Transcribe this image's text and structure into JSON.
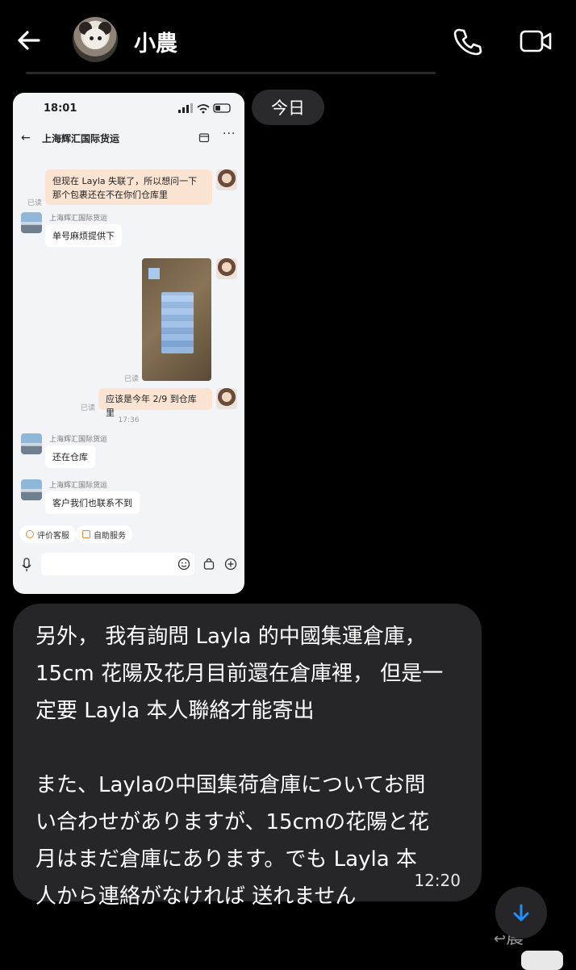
{
  "header": {
    "contact_name": "小農",
    "icons": {
      "back": "back-arrow-icon",
      "call": "phone-icon",
      "video": "video-camera-icon"
    }
  },
  "date_divider": "今日",
  "embedded_screenshot": {
    "status_time": "18:01",
    "title": "上海辉汇国际货运",
    "messages": [
      {
        "from": "me",
        "text": "但现在 Layla 失联了，所以想问一下那个包裹还在不在你们仓库里",
        "status": "已读"
      },
      {
        "from": "them",
        "sender": "上海辉汇国际货运",
        "text": "单号麻烦提供下"
      },
      {
        "from": "me",
        "type": "image",
        "status": "已读"
      },
      {
        "from": "me",
        "text": "应该是今年 2/9 到仓库里",
        "status": "已读"
      },
      {
        "timestamp": "17:36"
      },
      {
        "from": "them",
        "sender": "上海辉汇国际货运",
        "text": "还在仓库"
      },
      {
        "from": "them",
        "sender": "上海辉汇国际货运",
        "text": "客户我们也联系不到"
      }
    ],
    "quick_actions": [
      "评价客服",
      "自助服务"
    ]
  },
  "message": {
    "paragraph_zh": "另外， 我有詢問 Layla 的中國集運倉庫，\n15cm 花陽及花月目前還在倉庫裡， 但是一\n定要 Layla 本人聯絡才能寄出",
    "paragraph_ja": "また、Laylaの中国集荷倉庫についてお問\nい合わせがありますが、15cmの花陽と花\n月はまだ倉庫にあります。でも Layla 本\n人から連絡がなければ 送れません",
    "time": "12:20"
  },
  "bottom": {
    "reply_hint": "農",
    "scroll_icon": "arrow-down-icon"
  },
  "colors": {
    "accent": "#1e90ff",
    "bubble_bg": "#262628",
    "background": "#000000"
  }
}
